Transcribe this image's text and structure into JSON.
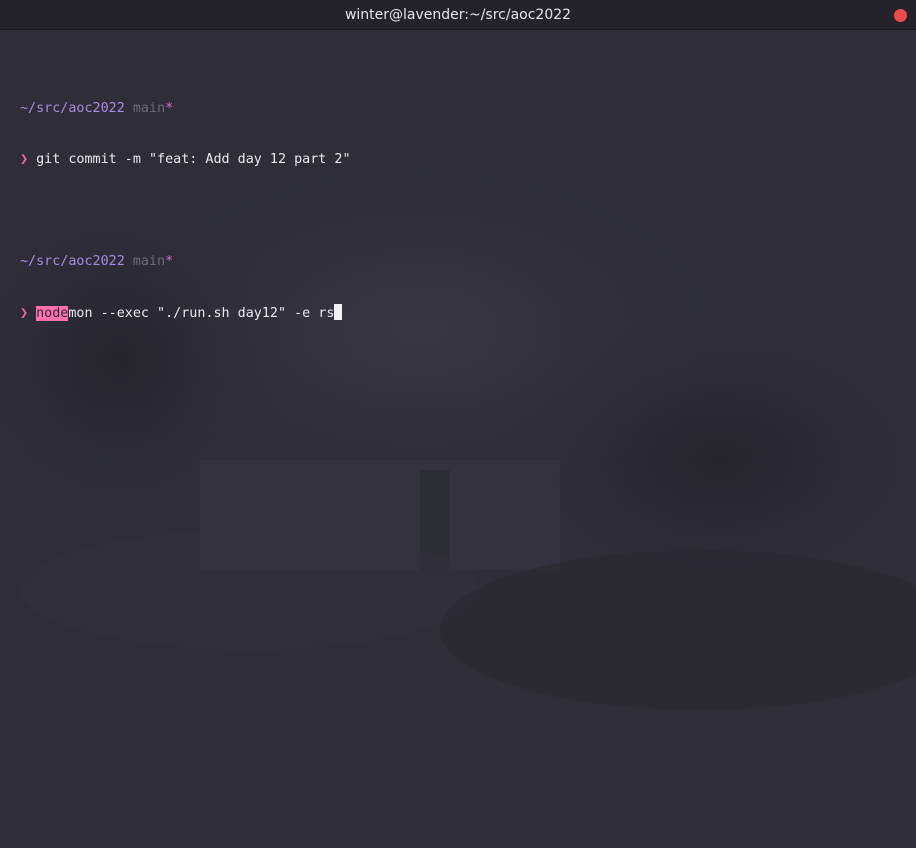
{
  "window": {
    "title": "winter@lavender:~/src/aoc2022"
  },
  "terminal": {
    "blocks": [
      {
        "path": "~/src/aoc2022",
        "branch": "main",
        "dirty_marker": "*",
        "prompt_symbol": "❯",
        "command": "git commit -m \"feat: Add day 12 part 2\""
      },
      {
        "path": "~/src/aoc2022",
        "branch": "main",
        "dirty_marker": "*",
        "prompt_symbol": "❯",
        "command_highlight": "node",
        "command_rest": "mon --exec \"./run.sh day12\" -e rs"
      }
    ]
  },
  "colors": {
    "background": "#2e2d38",
    "path": "#a98be3",
    "branch": "#6e6a78",
    "dirty": "#d66fd0",
    "prompt": "#f06ba3",
    "highlight": "#ff6fae",
    "close_button": "#ef4b4b"
  },
  "icons": {
    "close": "close-icon"
  }
}
